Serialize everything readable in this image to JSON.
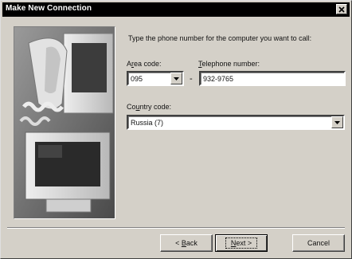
{
  "window": {
    "title": "Make New Connection",
    "close_icon": "close-x-icon"
  },
  "instructions": "Type the phone number for the computer you want to call:",
  "area_code": {
    "label_pre": "A",
    "label_key": "r",
    "label_post": "ea code:",
    "value": "095"
  },
  "separator_dash": "-",
  "telephone": {
    "label_key": "T",
    "label_post": "elephone number:",
    "value": "932-9765"
  },
  "country_code": {
    "label_pre": "Co",
    "label_key": "u",
    "label_post": "ntry code:",
    "value": "Russia (7)"
  },
  "buttons": {
    "back": {
      "pre": "< ",
      "key": "B",
      "post": "ack"
    },
    "next": {
      "key": "N",
      "post": "ext >"
    },
    "cancel": "Cancel"
  },
  "colors": {
    "face": "#d4d0c8",
    "titlebar": "#000000",
    "field": "#ffffff"
  }
}
